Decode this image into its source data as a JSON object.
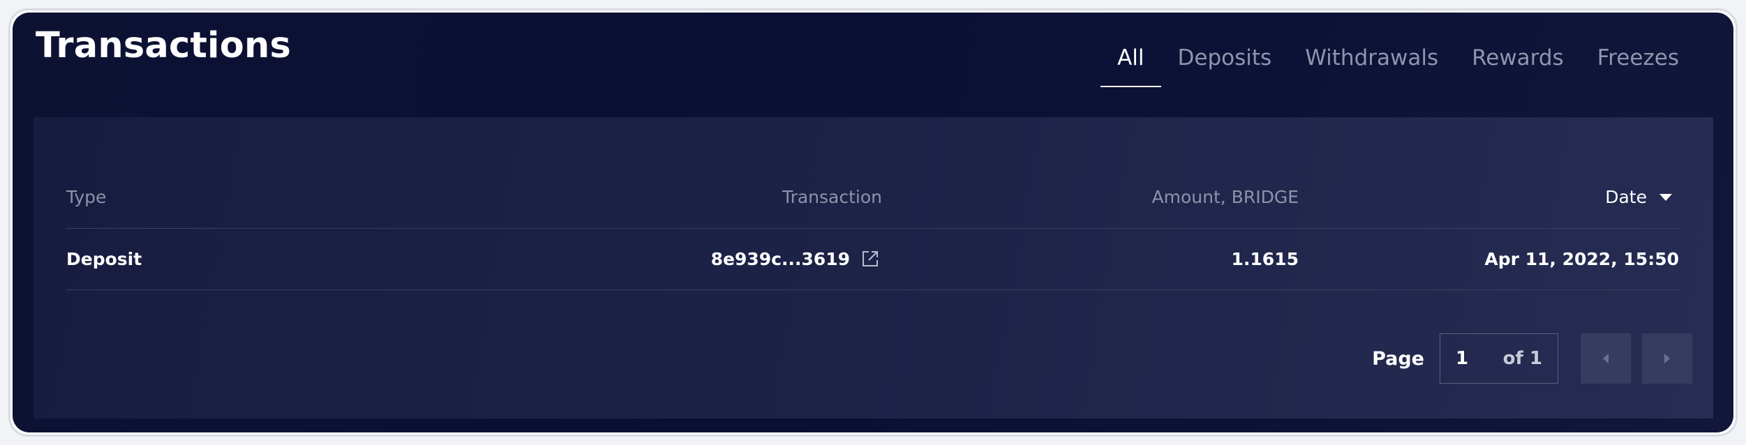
{
  "header": {
    "title": "Transactions"
  },
  "tabs": [
    {
      "label": "All",
      "active": true
    },
    {
      "label": "Deposits",
      "active": false
    },
    {
      "label": "Withdrawals",
      "active": false
    },
    {
      "label": "Rewards",
      "active": false
    },
    {
      "label": "Freezes",
      "active": false
    }
  ],
  "table": {
    "columns": {
      "type": "Type",
      "transaction": "Transaction",
      "amount": "Amount, BRIDGE",
      "date": "Date"
    },
    "sort_icon": "caret-down-icon",
    "rows": [
      {
        "type": "Deposit",
        "transaction": "8e939c...3619",
        "amount": "1.1615",
        "date": "Apr 11, 2022, 15:50"
      }
    ]
  },
  "pagination": {
    "label": "Page",
    "current": "1",
    "of_text": "of 1",
    "prev_icon": "chevron-left-icon",
    "next_icon": "chevron-right-icon"
  },
  "colors": {
    "background": "#0b1034",
    "panel": "#1d2247",
    "muted_text": "#8f95ad",
    "button": "#363c5f"
  }
}
